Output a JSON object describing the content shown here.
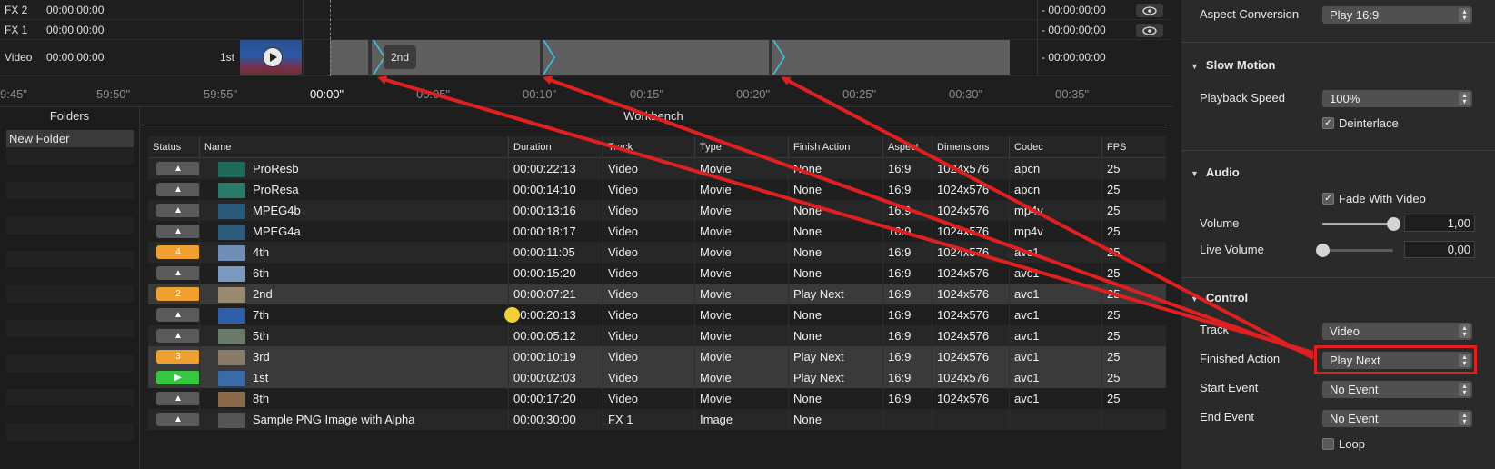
{
  "tracks": [
    {
      "label": "FX 2",
      "timecode": "00:00:00:00",
      "end": "- 00:00:00:00"
    },
    {
      "label": "FX 1",
      "timecode": "00:00:00:00",
      "end": "- 00:00:00:00"
    },
    {
      "label": "Video",
      "timecode": "00:00:00:00",
      "end": "- 00:00:00:00"
    }
  ],
  "timeline": {
    "clip_1st_label": "1st",
    "clip_2nd_label": "2nd",
    "ticks": [
      "9:45\"",
      "59:50\"",
      "59:55\"",
      "00:00\"",
      "00:05\"",
      "00:10\"",
      "00:15\"",
      "00:20\"",
      "00:25\"",
      "00:30\"",
      "00:35\""
    ]
  },
  "folders": {
    "header": "Folders",
    "items": [
      "New Folder"
    ]
  },
  "workbench": {
    "header": "Workbench",
    "columns": [
      "Status",
      "Name",
      "Duration",
      "Track",
      "Type",
      "Finish Action",
      "Aspect",
      "Dimensions",
      "Codec",
      "FPS"
    ],
    "rows": [
      {
        "status": "▲",
        "status_color": "gray",
        "thumb": "#1f6b5a",
        "name": "ProResb",
        "duration": "00:00:22:13",
        "track": "Video",
        "type": "Movie",
        "finish": "None",
        "aspect": "16:9",
        "dim": "1024x576",
        "codec": "apcn",
        "fps": "25"
      },
      {
        "status": "▲",
        "status_color": "gray",
        "thumb": "#2a7a6a",
        "name": "ProResa",
        "duration": "00:00:14:10",
        "track": "Video",
        "type": "Movie",
        "finish": "None",
        "aspect": "16:9",
        "dim": "1024x576",
        "codec": "apcn",
        "fps": "25"
      },
      {
        "status": "▲",
        "status_color": "gray",
        "thumb": "#2a5a7a",
        "name": "MPEG4b",
        "duration": "00:00:13:16",
        "track": "Video",
        "type": "Movie",
        "finish": "None",
        "aspect": "16:9",
        "dim": "1024x576",
        "codec": "mp4v",
        "fps": "25"
      },
      {
        "status": "▲",
        "status_color": "gray",
        "thumb": "#2d5d7d",
        "name": "MPEG4a",
        "duration": "00:00:18:17",
        "track": "Video",
        "type": "Movie",
        "finish": "None",
        "aspect": "16:9",
        "dim": "1024x576",
        "codec": "mp4v",
        "fps": "25"
      },
      {
        "status": "4",
        "status_color": "orange",
        "thumb": "#6f8fb8",
        "name": "4th",
        "duration": "00:00:11:05",
        "track": "Video",
        "type": "Movie",
        "finish": "None",
        "aspect": "16:9",
        "dim": "1024x576",
        "codec": "avc1",
        "fps": "25"
      },
      {
        "status": "▲",
        "status_color": "gray",
        "thumb": "#7a9ac0",
        "name": "6th",
        "duration": "00:00:15:20",
        "track": "Video",
        "type": "Movie",
        "finish": "None",
        "aspect": "16:9",
        "dim": "1024x576",
        "codec": "avc1",
        "fps": "25"
      },
      {
        "status": "2",
        "status_color": "orange",
        "thumb": "#9a8a70",
        "name": "2nd",
        "duration": "00:00:07:21",
        "track": "Video",
        "type": "Movie",
        "finish": "Play Next",
        "aspect": "16:9",
        "dim": "1024x576",
        "codec": "avc1",
        "fps": "25"
      },
      {
        "status": "▲",
        "status_color": "gray",
        "thumb": "#2f5fa8",
        "name": "7th",
        "duration": "00:00:20:13",
        "track": "Video",
        "type": "Movie",
        "finish": "None",
        "aspect": "16:9",
        "dim": "1024x576",
        "codec": "avc1",
        "fps": "25"
      },
      {
        "status": "▲",
        "status_color": "gray",
        "thumb": "#6a7a6a",
        "name": "5th",
        "duration": "00:00:05:12",
        "track": "Video",
        "type": "Movie",
        "finish": "None",
        "aspect": "16:9",
        "dim": "1024x576",
        "codec": "avc1",
        "fps": "25"
      },
      {
        "status": "3",
        "status_color": "orange",
        "thumb": "#8a7a6a",
        "name": "3rd",
        "duration": "00:00:10:19",
        "track": "Video",
        "type": "Movie",
        "finish": "Play Next",
        "aspect": "16:9",
        "dim": "1024x576",
        "codec": "avc1",
        "fps": "25"
      },
      {
        "status": "▶",
        "status_color": "green",
        "thumb": "#3a6aa8",
        "name": "1st",
        "duration": "00:00:02:03",
        "track": "Video",
        "type": "Movie",
        "finish": "Play Next",
        "aspect": "16:9",
        "dim": "1024x576",
        "codec": "avc1",
        "fps": "25"
      },
      {
        "status": "▲",
        "status_color": "gray",
        "thumb": "#8a6a4a",
        "name": "8th",
        "duration": "00:00:17:20",
        "track": "Video",
        "type": "Movie",
        "finish": "None",
        "aspect": "16:9",
        "dim": "1024x576",
        "codec": "avc1",
        "fps": "25"
      },
      {
        "status": "▲",
        "status_color": "gray",
        "thumb": "#555555",
        "name": "Sample PNG Image with Alpha",
        "duration": "00:00:30:00",
        "track": "FX 1",
        "type": "Image",
        "finish": "None",
        "aspect": "",
        "dim": "",
        "codec": "",
        "fps": ""
      }
    ]
  },
  "inspector": {
    "aspect_conversion_label": "Aspect Conversion",
    "aspect_conversion_value": "Play 16:9",
    "slow_motion_title": "Slow Motion",
    "playback_speed_label": "Playback Speed",
    "playback_speed_value": "100%",
    "deinterlace_label": "Deinterlace",
    "audio_title": "Audio",
    "fade_with_video_label": "Fade With Video",
    "volume_label": "Volume",
    "volume_value": "1,00",
    "volume_level": 1.0,
    "live_volume_label": "Live Volume",
    "live_volume_value": "0,00",
    "live_volume_level": 0.0,
    "control_title": "Control",
    "track_label": "Track",
    "track_value": "Video",
    "finished_action_label": "Finished Action",
    "finished_action_value": "Play Next",
    "start_event_label": "Start Event",
    "start_event_value": "No Event",
    "end_event_label": "End Event",
    "end_event_value": "No Event",
    "loop_label": "Loop"
  },
  "colors": {
    "annotation_red": "#e02020",
    "marker_cyan": "#37c6e8",
    "status_orange": "#f0a030",
    "status_green": "#35c840"
  }
}
